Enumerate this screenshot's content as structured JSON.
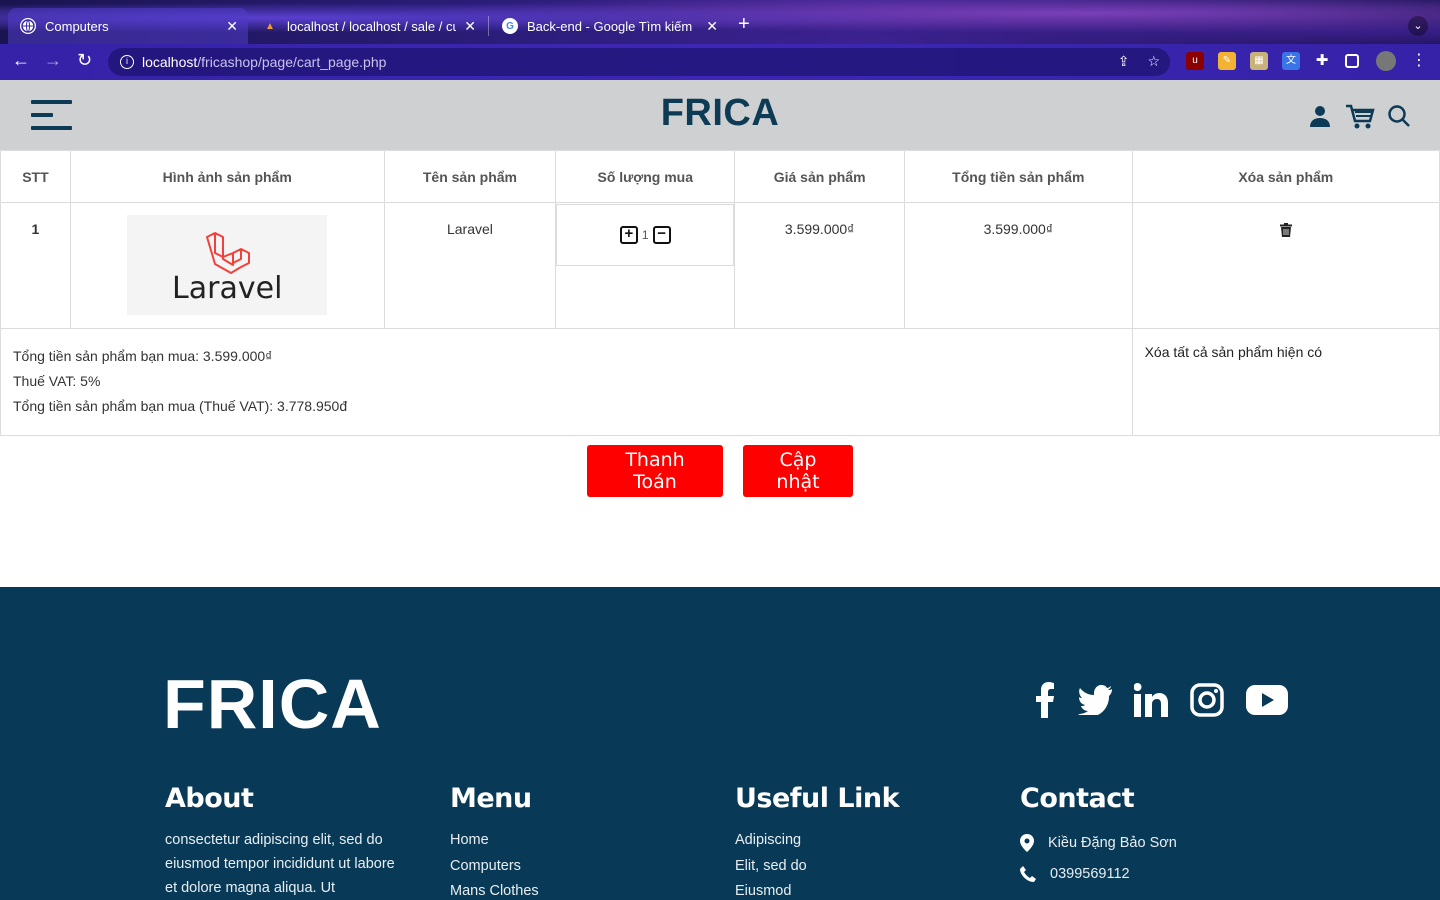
{
  "browser": {
    "tabs": [
      {
        "title": "Computers",
        "active": true
      },
      {
        "title": "localhost / localhost / sale / cu",
        "active": false
      },
      {
        "title": "Back-end - Google Tìm kiếm",
        "active": false
      }
    ],
    "url_host": "localhost",
    "url_path": "/fricashop/page/cart_page.php"
  },
  "header": {
    "logo": "FRICA"
  },
  "cart": {
    "columns": [
      "STT",
      "Hình ảnh sản phẩm",
      "Tên sản phẩm",
      "Số lượng mua",
      "Giá sản phẩm",
      "Tổng tiền sản phẩm",
      "Xóa sản phẩm"
    ],
    "items": [
      {
        "stt": "1",
        "image_text": "Laravel",
        "name": "Laravel",
        "quantity": "1",
        "price": "3.599.000₫",
        "total": "3.599.000₫"
      }
    ],
    "summary": {
      "subtotal": "Tổng tiền sản phẩm bạn mua: 3.599.000₫",
      "vat": "Thuế VAT: 5%",
      "grand_total": "Tổng tiền sản phẩm bạn mua (Thuế VAT): 3.778.950đ",
      "clear_all": "Xóa tất cả sản phẩm hiện có"
    },
    "checkout_label": "Thanh Toán",
    "update_label": "Cập nhật"
  },
  "footer": {
    "logo": "FRICA",
    "about": {
      "title": "About",
      "text": "consectetur adipiscing elit, sed do eiusmod tempor incididunt ut labore et dolore magna aliqua. Ut"
    },
    "menu": {
      "title": "Menu",
      "items": [
        "Home",
        "Computers",
        "Mans Clothes"
      ]
    },
    "useful": {
      "title": "Useful Link",
      "items": [
        "Adipiscing",
        "Elit, sed do",
        "Eiusmod"
      ]
    },
    "contact": {
      "title": "Contact",
      "name": "Kiều Đặng Bảo Sơn",
      "phone": "0399569112"
    }
  },
  "colors": {
    "brand_dark": "#0d3a55",
    "footer_bg": "#083a57",
    "button_red": "#ff0000",
    "header_bg": "#cfd0d2",
    "laravel_red": "#f4403a"
  }
}
